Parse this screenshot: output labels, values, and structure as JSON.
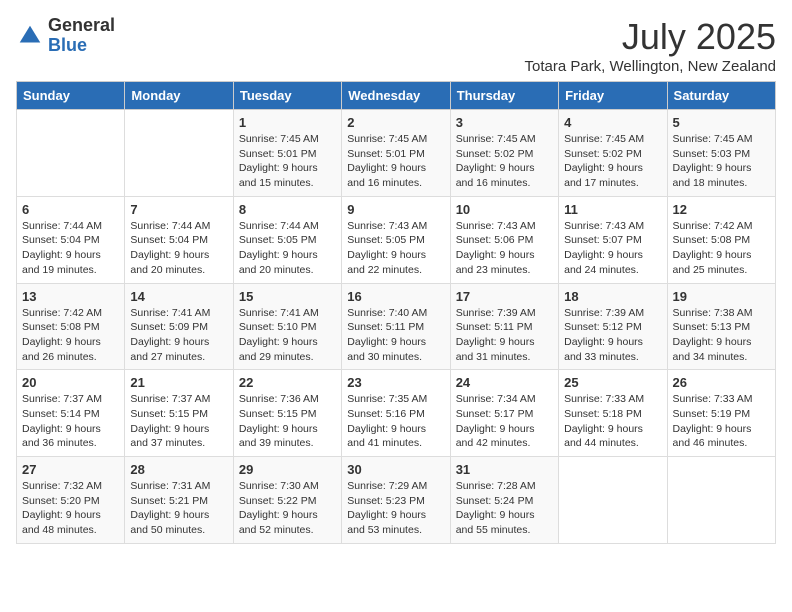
{
  "logo": {
    "general": "General",
    "blue": "Blue"
  },
  "title": {
    "month_year": "July 2025",
    "location": "Totara Park, Wellington, New Zealand"
  },
  "weekdays": [
    "Sunday",
    "Monday",
    "Tuesday",
    "Wednesday",
    "Thursday",
    "Friday",
    "Saturday"
  ],
  "weeks": [
    [
      {
        "day": "",
        "content": ""
      },
      {
        "day": "",
        "content": ""
      },
      {
        "day": "1",
        "content": "Sunrise: 7:45 AM\nSunset: 5:01 PM\nDaylight: 9 hours and 15 minutes."
      },
      {
        "day": "2",
        "content": "Sunrise: 7:45 AM\nSunset: 5:01 PM\nDaylight: 9 hours and 16 minutes."
      },
      {
        "day": "3",
        "content": "Sunrise: 7:45 AM\nSunset: 5:02 PM\nDaylight: 9 hours and 16 minutes."
      },
      {
        "day": "4",
        "content": "Sunrise: 7:45 AM\nSunset: 5:02 PM\nDaylight: 9 hours and 17 minutes."
      },
      {
        "day": "5",
        "content": "Sunrise: 7:45 AM\nSunset: 5:03 PM\nDaylight: 9 hours and 18 minutes."
      }
    ],
    [
      {
        "day": "6",
        "content": "Sunrise: 7:44 AM\nSunset: 5:04 PM\nDaylight: 9 hours and 19 minutes."
      },
      {
        "day": "7",
        "content": "Sunrise: 7:44 AM\nSunset: 5:04 PM\nDaylight: 9 hours and 20 minutes."
      },
      {
        "day": "8",
        "content": "Sunrise: 7:44 AM\nSunset: 5:05 PM\nDaylight: 9 hours and 20 minutes."
      },
      {
        "day": "9",
        "content": "Sunrise: 7:43 AM\nSunset: 5:05 PM\nDaylight: 9 hours and 22 minutes."
      },
      {
        "day": "10",
        "content": "Sunrise: 7:43 AM\nSunset: 5:06 PM\nDaylight: 9 hours and 23 minutes."
      },
      {
        "day": "11",
        "content": "Sunrise: 7:43 AM\nSunset: 5:07 PM\nDaylight: 9 hours and 24 minutes."
      },
      {
        "day": "12",
        "content": "Sunrise: 7:42 AM\nSunset: 5:08 PM\nDaylight: 9 hours and 25 minutes."
      }
    ],
    [
      {
        "day": "13",
        "content": "Sunrise: 7:42 AM\nSunset: 5:08 PM\nDaylight: 9 hours and 26 minutes."
      },
      {
        "day": "14",
        "content": "Sunrise: 7:41 AM\nSunset: 5:09 PM\nDaylight: 9 hours and 27 minutes."
      },
      {
        "day": "15",
        "content": "Sunrise: 7:41 AM\nSunset: 5:10 PM\nDaylight: 9 hours and 29 minutes."
      },
      {
        "day": "16",
        "content": "Sunrise: 7:40 AM\nSunset: 5:11 PM\nDaylight: 9 hours and 30 minutes."
      },
      {
        "day": "17",
        "content": "Sunrise: 7:39 AM\nSunset: 5:11 PM\nDaylight: 9 hours and 31 minutes."
      },
      {
        "day": "18",
        "content": "Sunrise: 7:39 AM\nSunset: 5:12 PM\nDaylight: 9 hours and 33 minutes."
      },
      {
        "day": "19",
        "content": "Sunrise: 7:38 AM\nSunset: 5:13 PM\nDaylight: 9 hours and 34 minutes."
      }
    ],
    [
      {
        "day": "20",
        "content": "Sunrise: 7:37 AM\nSunset: 5:14 PM\nDaylight: 9 hours and 36 minutes."
      },
      {
        "day": "21",
        "content": "Sunrise: 7:37 AM\nSunset: 5:15 PM\nDaylight: 9 hours and 37 minutes."
      },
      {
        "day": "22",
        "content": "Sunrise: 7:36 AM\nSunset: 5:15 PM\nDaylight: 9 hours and 39 minutes."
      },
      {
        "day": "23",
        "content": "Sunrise: 7:35 AM\nSunset: 5:16 PM\nDaylight: 9 hours and 41 minutes."
      },
      {
        "day": "24",
        "content": "Sunrise: 7:34 AM\nSunset: 5:17 PM\nDaylight: 9 hours and 42 minutes."
      },
      {
        "day": "25",
        "content": "Sunrise: 7:33 AM\nSunset: 5:18 PM\nDaylight: 9 hours and 44 minutes."
      },
      {
        "day": "26",
        "content": "Sunrise: 7:33 AM\nSunset: 5:19 PM\nDaylight: 9 hours and 46 minutes."
      }
    ],
    [
      {
        "day": "27",
        "content": "Sunrise: 7:32 AM\nSunset: 5:20 PM\nDaylight: 9 hours and 48 minutes."
      },
      {
        "day": "28",
        "content": "Sunrise: 7:31 AM\nSunset: 5:21 PM\nDaylight: 9 hours and 50 minutes."
      },
      {
        "day": "29",
        "content": "Sunrise: 7:30 AM\nSunset: 5:22 PM\nDaylight: 9 hours and 52 minutes."
      },
      {
        "day": "30",
        "content": "Sunrise: 7:29 AM\nSunset: 5:23 PM\nDaylight: 9 hours and 53 minutes."
      },
      {
        "day": "31",
        "content": "Sunrise: 7:28 AM\nSunset: 5:24 PM\nDaylight: 9 hours and 55 minutes."
      },
      {
        "day": "",
        "content": ""
      },
      {
        "day": "",
        "content": ""
      }
    ]
  ]
}
